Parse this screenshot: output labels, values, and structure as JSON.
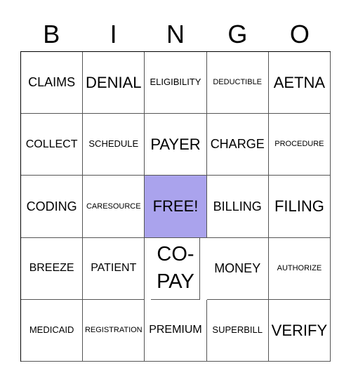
{
  "header": {
    "letters": [
      "B",
      "I",
      "N",
      "G",
      "O"
    ]
  },
  "free_color": "#aaa3ed",
  "cells": [
    {
      "text": "CLAIMS",
      "size": "m"
    },
    {
      "text": "DENIAL",
      "size": "l"
    },
    {
      "text": "ELIGIBILITY",
      "size": "xs"
    },
    {
      "text": "DEDUCTIBLE",
      "size": "xxs"
    },
    {
      "text": "AETNA",
      "size": "l"
    },
    {
      "text": "COLLECT",
      "size": "s"
    },
    {
      "text": "SCHEDULE",
      "size": "xs"
    },
    {
      "text": "PAYER",
      "size": "l"
    },
    {
      "text": "CHARGE",
      "size": "m"
    },
    {
      "text": "PROCEDURE",
      "size": "xxs"
    },
    {
      "text": "CODING",
      "size": "m"
    },
    {
      "text": "CARESOURCE",
      "size": "xxs"
    },
    {
      "text": "FREE!",
      "size": "l",
      "free": true
    },
    {
      "text": "BILLING",
      "size": "m"
    },
    {
      "text": "FILING",
      "size": "l"
    },
    {
      "text": "BREEZE",
      "size": "s"
    },
    {
      "text": "PATIENT",
      "size": "s"
    },
    {
      "text": "CO-PAY",
      "size": "xl"
    },
    {
      "text": "MONEY",
      "size": "m"
    },
    {
      "text": "AUTHORIZE",
      "size": "xxs"
    },
    {
      "text": "MEDICAID",
      "size": "xs"
    },
    {
      "text": "REGISTRATION",
      "size": "xxs"
    },
    {
      "text": "PREMIUM",
      "size": "s"
    },
    {
      "text": "SUPERBILL",
      "size": "xs"
    },
    {
      "text": "VERIFY",
      "size": "l"
    }
  ]
}
